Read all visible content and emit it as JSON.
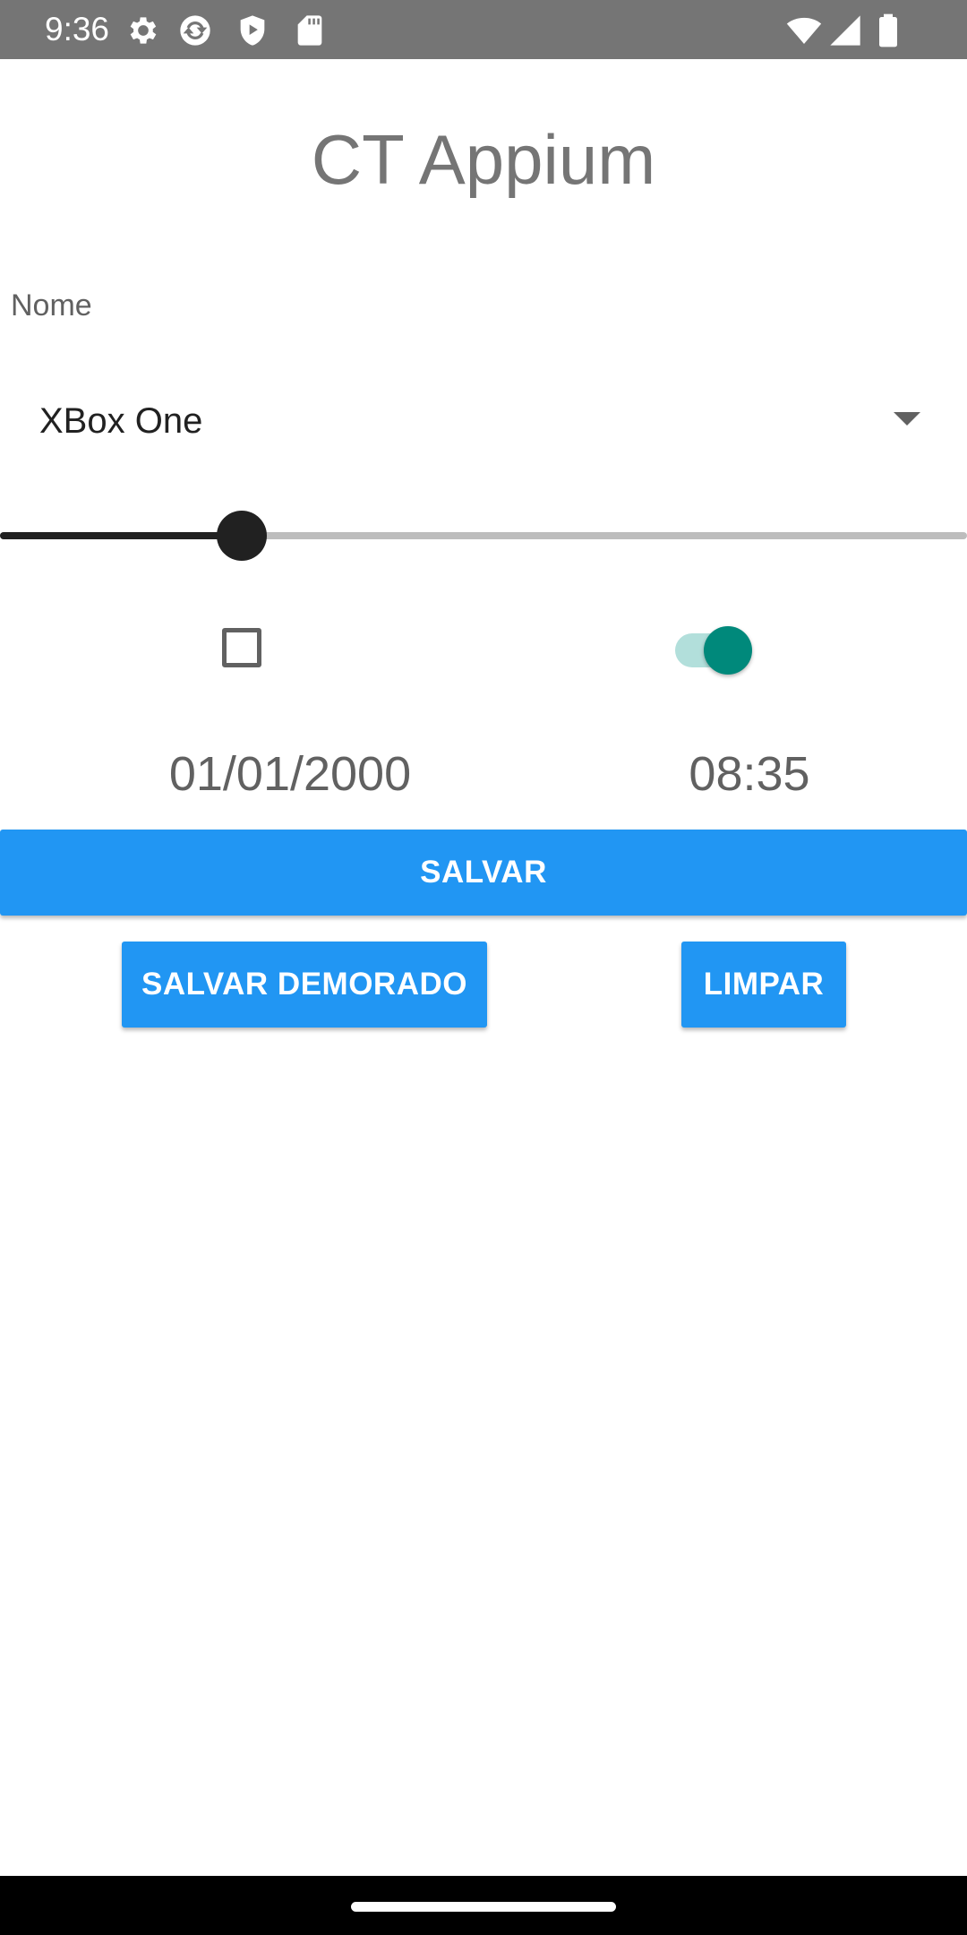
{
  "status_bar": {
    "time": "9:36",
    "left_icons": [
      "gear-icon",
      "sync-icon",
      "shield-play-icon",
      "sd-card-icon"
    ],
    "right_icons": [
      "wifi-icon",
      "signal-icon",
      "battery-icon"
    ],
    "background": "#757575"
  },
  "app": {
    "title": "CT Appium"
  },
  "form": {
    "name_label": "Nome",
    "spinner_value": "XBox One",
    "slider_level": 0.25,
    "checkbox_checked": false,
    "switch_on": true,
    "date": "01/01/2000",
    "time": "08:35"
  },
  "buttons": {
    "salvar": "SALVAR",
    "salvar_demorado": "SALVAR DEMORADO",
    "limpar": "LIMPAR"
  },
  "colors": {
    "primary": "#2196f3",
    "switch_accent": "#00897b",
    "switch_track": "#b2dfdb"
  }
}
